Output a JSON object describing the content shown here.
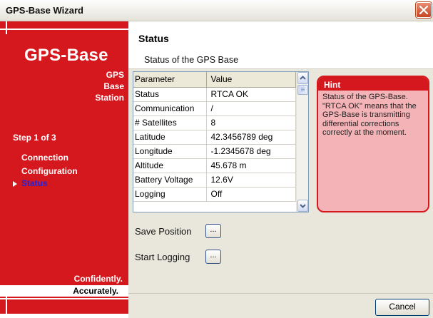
{
  "window": {
    "title": "GPS-Base Wizard",
    "close_icon": "close-icon"
  },
  "brand": {
    "logo": "GPS-Base",
    "subtitle_lines": [
      "GPS",
      "Base",
      "Station"
    ],
    "slogan_line1": "Confidently.",
    "slogan_line2": "Accurately.",
    "color": "#d5181e"
  },
  "steps": {
    "label": "Step 1 of 3",
    "items": [
      {
        "label": "Connection",
        "active": false
      },
      {
        "label": "Configuration",
        "active": false
      },
      {
        "label": "Status",
        "active": true
      }
    ]
  },
  "header": {
    "title": "Status",
    "subtitle": "Status of the GPS Base"
  },
  "grid": {
    "columns": [
      "Parameter",
      "Value"
    ],
    "rows": [
      [
        "Status",
        "RTCA OK"
      ],
      [
        "Communication",
        "/"
      ],
      [
        "# Satellites",
        "8"
      ],
      [
        "Latitude",
        "42.3456789 deg"
      ],
      [
        "Longitude",
        "-1.2345678 deg"
      ],
      [
        "Altitude",
        "45.678 m"
      ],
      [
        "Battery Voltage",
        "12.6V"
      ],
      [
        "Logging",
        "Off"
      ]
    ]
  },
  "hint": {
    "title": "Hint",
    "body": "Status of the GPS-Base. \"RTCA OK\" means that the GPS-Base is transmitting differential corrections correctly at the moment."
  },
  "actions": {
    "save_position_label": "Save Position",
    "start_logging_label": "Start Logging",
    "ellipsis": "...",
    "cancel_label": "Cancel"
  }
}
